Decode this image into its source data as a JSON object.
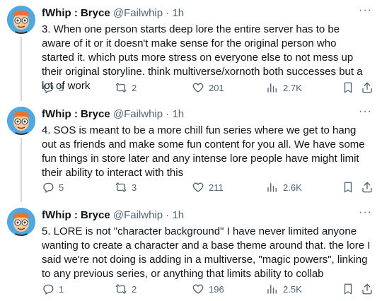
{
  "tweets": [
    {
      "author": "fWhip : Bryce",
      "handle": "@Failwhip",
      "dot": "·",
      "time": "1h",
      "text": "3. When one person starts deep lore the entire server has to be aware of it or it doesn't make sense for the original person who started it. which puts more stress on everyone else to not mess up their original storyline. think multiverse/xornoth both successes but a lot of work",
      "replies": "3",
      "retweets": "2",
      "likes": "201",
      "views": "2.7K"
    },
    {
      "author": "fWhip : Bryce",
      "handle": "@Failwhip",
      "dot": "·",
      "time": "1h",
      "text": "4. SOS is meant to be a more chill fun series where we get to hang out as friends and make some fun content for you all. We have some fun things in store later and any intense lore people have might limit their ability to interact with this",
      "replies": "5",
      "retweets": "3",
      "likes": "211",
      "views": "2.6K"
    },
    {
      "author": "fWhip : Bryce",
      "handle": "@Failwhip",
      "dot": "·",
      "time": "1h",
      "text": "5. LORE is not \"character background\" I have never limited anyone wanting to create a character and a base theme around that. the lore I said we're not doing is adding in a multiverse, \"magic powers\", linking to any previous series, or anything that limits ability to collab",
      "replies": "1",
      "retweets": "2",
      "likes": "196",
      "views": "2.5K"
    }
  ],
  "more_label": "···",
  "colors": {
    "text": "#0f1419",
    "muted": "#536471",
    "thread": "#cfd9de",
    "avatar_bg": "#4fa8e0"
  },
  "icons": [
    "reply-icon",
    "retweet-icon",
    "like-icon",
    "views-icon",
    "bookmark-icon",
    "share-icon",
    "more-icon"
  ]
}
